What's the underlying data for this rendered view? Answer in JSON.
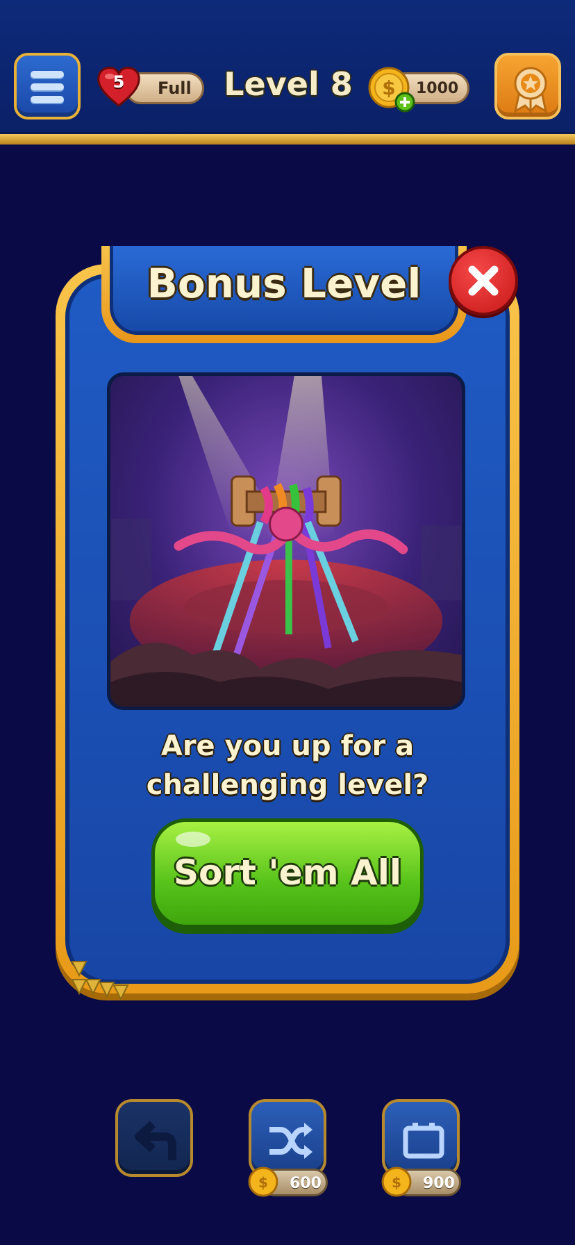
{
  "header": {
    "lives_count": "5",
    "lives_status": "Full",
    "level_title": "Level 8",
    "coins": "1000"
  },
  "modal": {
    "title": "Bonus Level",
    "prompt_line1": "Are you up for a",
    "prompt_line2": "challenging level?",
    "cta_label": "Sort 'em All"
  },
  "tools": [
    {
      "name": "undo",
      "icon": "undo-arrow-icon",
      "price": null
    },
    {
      "name": "shuffle",
      "icon": "shuffle-icon",
      "price": "600"
    },
    {
      "name": "add-slot",
      "icon": "battery-slot-icon",
      "price": "900"
    }
  ],
  "colors": {
    "background": "#0a0a46",
    "modal_frame": "#f9c44a",
    "modal_body": "#1f5bc4",
    "cta_green": "#56c21a",
    "close_red": "#e02a2a"
  }
}
